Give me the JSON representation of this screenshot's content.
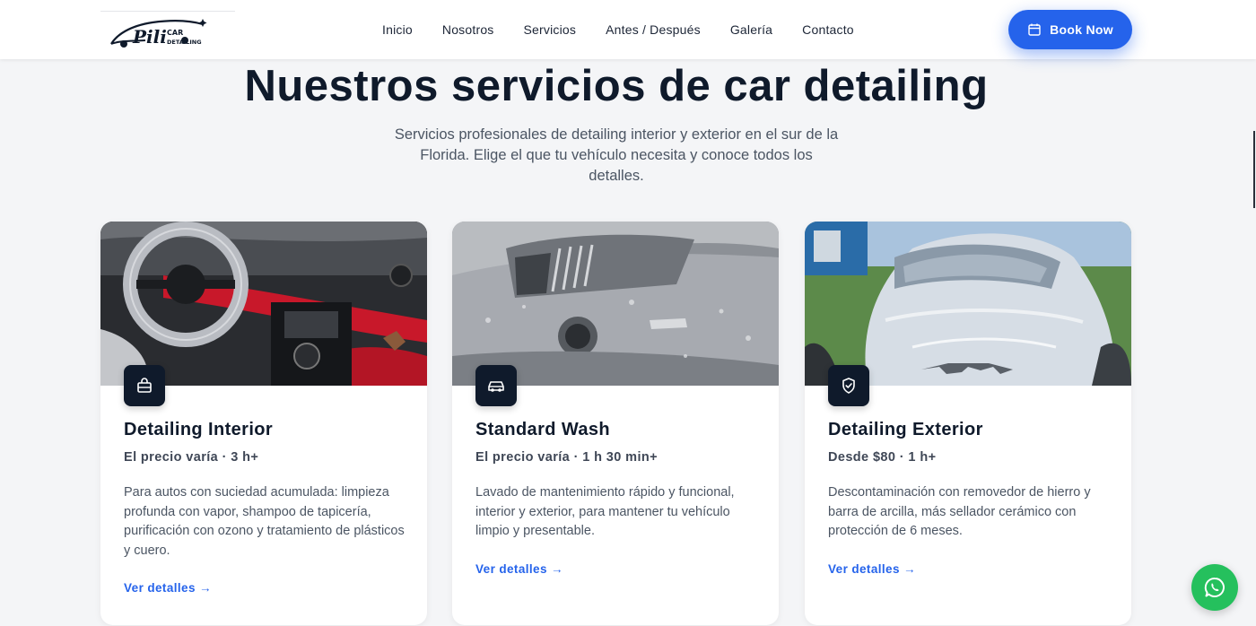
{
  "header": {
    "logo_alt": "Pili Car Detailing",
    "nav": [
      {
        "label": "Inicio"
      },
      {
        "label": "Nosotros"
      },
      {
        "label": "Servicios"
      },
      {
        "label": "Antes / Después"
      },
      {
        "label": "Galería"
      },
      {
        "label": "Contacto"
      }
    ],
    "book_label": "Book Now",
    "book_icon": "calendar-icon",
    "accent": "#2563eb"
  },
  "hero": {
    "title": "Nuestros servicios de car detailing",
    "subtitle": "Servicios profesionales de detailing interior y exterior en el sur de la Florida. Elige el que tu vehículo necesita y conoce todos los detalles."
  },
  "cards": [
    {
      "icon": "briefcase-icon",
      "title": "Detailing Interior",
      "meta": "El precio varía · 3 h+",
      "desc": "Para autos con suciedad acumulada: limpieza profunda con vapor, shampoo de tapicería, purificación con ozono y tratamiento de plásticos y cuero.",
      "link": "Ver detalles →"
    },
    {
      "icon": "car-icon",
      "title": "Standard Wash",
      "meta": "El precio varía · 1 h 30 min+",
      "desc": "Lavado de mantenimiento rápido y funcional, interior y exterior, para mantener tu vehículo limpio y presentable.",
      "link": "Ver detalles →"
    },
    {
      "icon": "shield-check-icon",
      "title": "Detailing Exterior",
      "meta": "Desde $80 · 1 h+",
      "desc": "Descontaminación con removedor de hierro y barra de arcilla, más sellador cerámico con protección de 6 meses.",
      "link": "Ver detalles →"
    }
  ],
  "whatsapp_icon": "whatsapp-icon"
}
